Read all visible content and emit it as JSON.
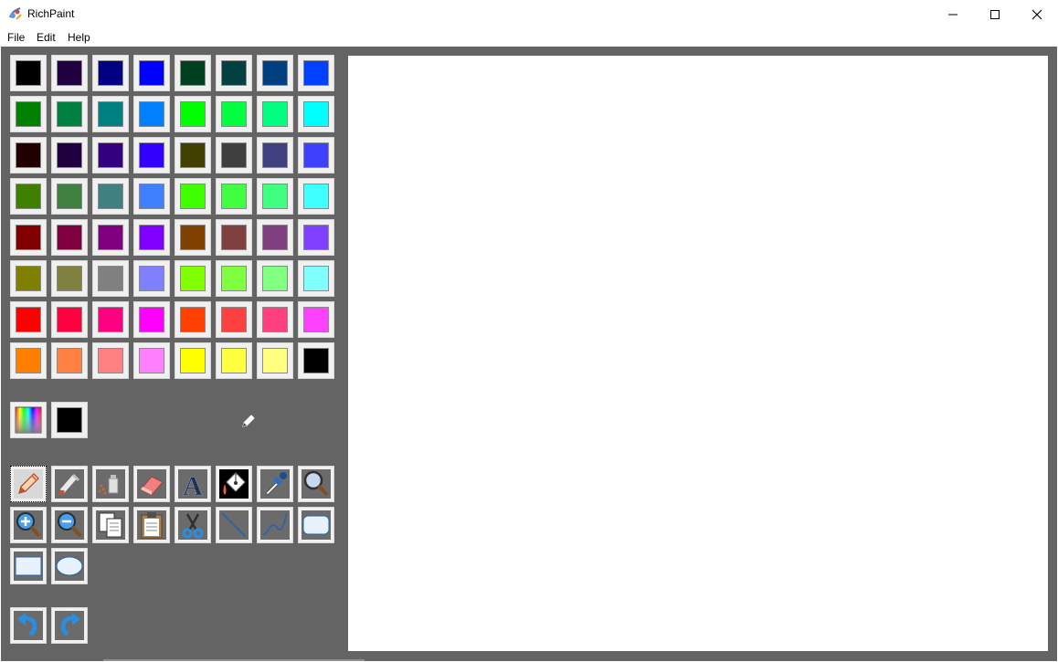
{
  "window": {
    "title": "RichPaint",
    "controls": [
      "minimize",
      "maximize",
      "close"
    ]
  },
  "menu": {
    "file": "File",
    "edit": "Edit",
    "help": "Help"
  },
  "palette": {
    "colors": [
      "#000000",
      "#200040",
      "#000080",
      "#0000ff",
      "#003f1f",
      "#004040",
      "#004080",
      "#0040ff",
      "#008000",
      "#008040",
      "#008080",
      "#0080ff",
      "#00ff00",
      "#00ff40",
      "#00ff80",
      "#00ffff",
      "#200000",
      "#200040",
      "#330080",
      "#3300ff",
      "#404000",
      "#404040",
      "#404080",
      "#4040ff",
      "#408000",
      "#408040",
      "#408080",
      "#4080ff",
      "#40ff00",
      "#40ff40",
      "#40ff80",
      "#40ffff",
      "#800000",
      "#800040",
      "#800080",
      "#8000ff",
      "#804000",
      "#804040",
      "#804080",
      "#8040ff",
      "#808000",
      "#808040",
      "#808080",
      "#8080ff",
      "#80ff00",
      "#80ff40",
      "#80ff80",
      "#80ffff",
      "#ff0000",
      "#ff0040",
      "#ff0080",
      "#ff00ff",
      "#ff4000",
      "#ff4040",
      "#ff4080",
      "#ff40ff",
      "#ff8000",
      "#ff8040",
      "#ff8080",
      "#ff80ff",
      "#ffff00",
      "#ffff40",
      "#ffff80",
      "#000000"
    ],
    "current_color": "#000000"
  },
  "tools": [
    {
      "name": "pencil-tool",
      "icon": "pencil-icon",
      "selected": true
    },
    {
      "name": "brush-tool",
      "icon": "brush-icon"
    },
    {
      "name": "spray-tool",
      "icon": "spray-icon"
    },
    {
      "name": "eraser-tool",
      "icon": "eraser-icon"
    },
    {
      "name": "text-tool",
      "icon": "text-icon",
      "glyph": "A"
    },
    {
      "name": "fill-tool",
      "icon": "paint-bucket-icon"
    },
    {
      "name": "color-picker-tool",
      "icon": "eyedropper-icon"
    },
    {
      "name": "magnifier-tool",
      "icon": "magnifier-icon"
    },
    {
      "name": "zoom-in-tool",
      "icon": "zoom-in-icon"
    },
    {
      "name": "zoom-out-tool",
      "icon": "zoom-out-icon"
    },
    {
      "name": "copy-tool",
      "icon": "copy-icon"
    },
    {
      "name": "paste-tool",
      "icon": "clipboard-icon"
    },
    {
      "name": "cut-tool",
      "icon": "scissors-icon"
    },
    {
      "name": "line-tool",
      "icon": "line-icon"
    },
    {
      "name": "curve-tool",
      "icon": "curve-icon"
    },
    {
      "name": "rounded-rect-tool",
      "icon": "rounded-rectangle-icon"
    },
    {
      "name": "rectangle-tool",
      "icon": "rectangle-icon"
    },
    {
      "name": "ellipse-tool",
      "icon": "ellipse-icon"
    }
  ],
  "history": [
    {
      "name": "undo-button",
      "icon": "undo-icon"
    },
    {
      "name": "redo-button",
      "icon": "redo-icon"
    }
  ],
  "active_tool_indicator": "pencil-icon"
}
